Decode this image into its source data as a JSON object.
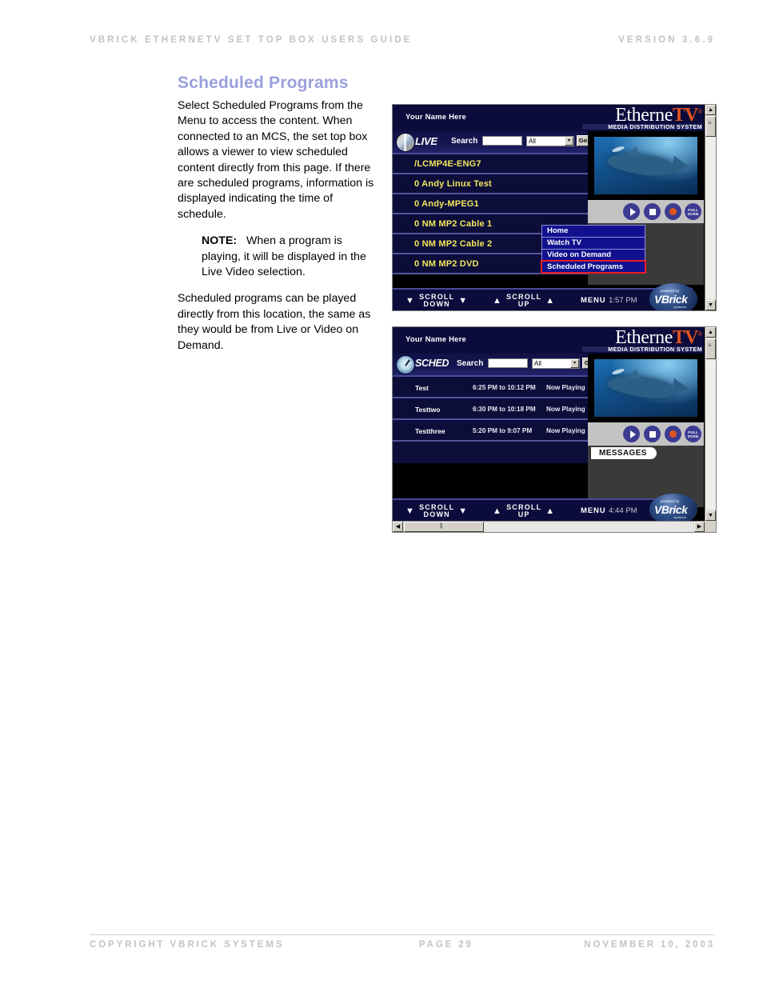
{
  "header": {
    "left": "VBRICK ETHERNETV SET TOP BOX USERS GUIDE",
    "right": "VERSION 3.6.9"
  },
  "footer": {
    "left": "COPYRIGHT VBRICK SYSTEMS",
    "center": "PAGE 29",
    "right": "NOVEMBER 10, 2003"
  },
  "body": {
    "title": "Scheduled Programs",
    "paragraph1": "Select Scheduled Programs from the Menu to access the content.  When connected to an MCS, the set top box allows a viewer to view scheduled content directly from this page.  If there are scheduled programs, information is displayed indicating the time of schedule.",
    "note_label": "NOTE:",
    "note_text": "When a program is playing, it will be displayed in the Live Video selection.",
    "paragraph2": "Scheduled programs can be played directly from this location, the same as they would be from Live or Video on Demand."
  },
  "figure1": {
    "your_name": "Your Name Here",
    "logo": {
      "word1": "Etherne",
      "word2": "TV",
      "reg": "®",
      "tagline": "MEDIA DISTRIBUTION SYSTEM"
    },
    "mode_label": "LIVE",
    "search_label": "Search",
    "search_value": "",
    "filter_value": "All",
    "go_label": "Go",
    "channels": [
      "/LCMP4E-ENG7",
      "0 Andy Linux Test",
      "0 Andy-MPEG1",
      "0 NM MP2 Cable 1",
      "0 NM MP2 Cable 2",
      "0 NM MP2 DVD"
    ],
    "menu_items": [
      "Home",
      "Watch TV",
      "Video on Demand",
      "Scheduled Programs"
    ],
    "menu_highlighted": "Scheduled Programs",
    "nav": {
      "scroll_down_l1": "SCROLL",
      "scroll_down_l2": "DOWN",
      "scroll_up_l1": "SCROLL",
      "scroll_up_l2": "UP",
      "menu_label": "MENU",
      "time": "1:57 PM"
    },
    "vbrick": {
      "powered": "powered by",
      "name": "VBrick",
      "systems": "systems"
    },
    "controls": {
      "play": "play-button",
      "stop": "stop-button",
      "record": "record-button",
      "full_l1": "FULL",
      "full_l2": "SCRN"
    }
  },
  "figure2": {
    "your_name": "Your Name Here",
    "logo": {
      "word1": "Etherne",
      "word2": "TV",
      "reg": "®",
      "tagline": "MEDIA DISTRIBUTION SYSTEM"
    },
    "mode_label": "SCHED",
    "search_label": "Search",
    "search_value": "",
    "filter_value": "All",
    "go_label": "Go",
    "programs": [
      {
        "name": "Test",
        "time": "6:25 PM to 10:12 PM",
        "status": "Now Playing"
      },
      {
        "name": "Testtwo",
        "time": "6:30 PM to 10:18 PM",
        "status": "Now Playing"
      },
      {
        "name": "Testthree",
        "time": "5:20 PM to 9:07 PM",
        "status": "Now Playing"
      }
    ],
    "messages_label": "MESSAGES",
    "nav": {
      "scroll_down_l1": "SCROLL",
      "scroll_down_l2": "DOWN",
      "scroll_up_l1": "SCROLL",
      "scroll_up_l2": "UP",
      "menu_label": "MENU",
      "time": "4:44 PM"
    },
    "vbrick": {
      "powered": "powered by",
      "name": "VBrick",
      "systems": "systems"
    },
    "controls": {
      "play": "play-button",
      "stop": "stop-button",
      "record": "record-button",
      "full_l1": "FULL",
      "full_l2": "SCRN"
    }
  },
  "colors": {
    "title": "#9aa0dd",
    "header_gray": "#c2c2c8",
    "stb_navy": "#0b0b3c",
    "channel_yellow": "#f2e85c",
    "highlight_red": "#ee1c24",
    "logo_orange": "#e0541e"
  }
}
